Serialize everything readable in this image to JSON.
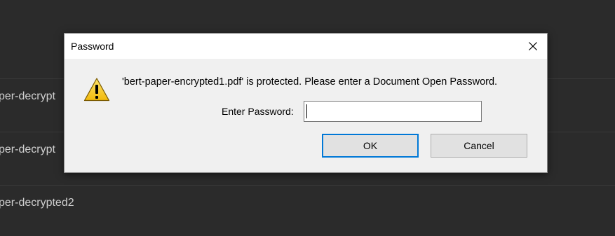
{
  "background": {
    "rows": [
      {
        "label": "per-decrypt"
      },
      {
        "label": "per-decrypt"
      },
      {
        "label": "per-decrypted2"
      }
    ]
  },
  "dialog": {
    "title": "Password",
    "message": "'bert-paper-encrypted1.pdf' is protected. Please enter a Document Open Password.",
    "password_label": "Enter Password:",
    "password_value": "",
    "ok_label": "OK",
    "cancel_label": "Cancel",
    "icons": {
      "close": "close-icon",
      "warning": "warning-icon"
    }
  },
  "colors": {
    "focus_border": "#0078d7",
    "warning_fill": "#f5c518"
  }
}
